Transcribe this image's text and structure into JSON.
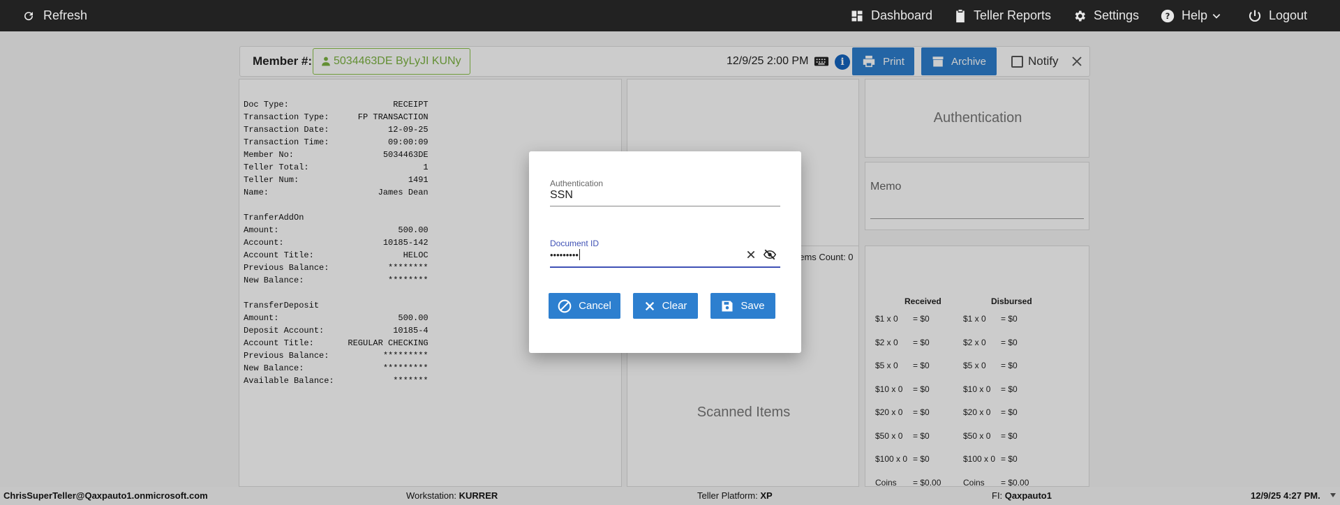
{
  "topbar": {
    "refresh": "Refresh",
    "dashboard": "Dashboard",
    "teller_reports": "Teller Reports",
    "settings": "Settings",
    "help": "Help",
    "logout": "Logout"
  },
  "header": {
    "member_label": "Member #:",
    "member_value": "5034463DE ByLyJI KUNy",
    "datetime": "12/9/25 2:00 PM",
    "print": "Print",
    "archive": "Archive",
    "notify": "Notify"
  },
  "receipt": {
    "rows": [
      {
        "k": "Doc Type:",
        "v": "RECEIPT"
      },
      {
        "k": "Transaction Type:",
        "v": "FP TRANSACTION"
      },
      {
        "k": "Transaction Date:",
        "v": "12-09-25"
      },
      {
        "k": "Transaction Time:",
        "v": "09:00:09"
      },
      {
        "k": "Member No:",
        "v": "5034463DE"
      },
      {
        "k": "Teller Total:",
        "v": "1"
      },
      {
        "k": "Teller Num:",
        "v": "1491"
      },
      {
        "k": "Name:",
        "v": "James Dean"
      },
      {
        "k": "",
        "v": ""
      },
      {
        "k": "TranferAddOn",
        "v": ""
      },
      {
        "k": "Amount:",
        "v": "500.00"
      },
      {
        "k": "Account:",
        "v": "10185-142"
      },
      {
        "k": "Account Title:",
        "v": "HELOC"
      },
      {
        "k": "Previous Balance:",
        "v": "********"
      },
      {
        "k": "New Balance:",
        "v": "********"
      },
      {
        "k": "",
        "v": ""
      },
      {
        "k": "TransferDeposit",
        "v": ""
      },
      {
        "k": "Amount:",
        "v": "500.00"
      },
      {
        "k": "Deposit Account:",
        "v": "10185-4"
      },
      {
        "k": "Account Title:",
        "v": "REGULAR CHECKING"
      },
      {
        "k": "Previous Balance:",
        "v": "*********"
      },
      {
        "k": "New Balance:",
        "v": "*********"
      },
      {
        "k": "Available Balance:",
        "v": "*******"
      }
    ]
  },
  "items_count": "Items Count: 0",
  "scanned_items": "Scanned Items",
  "authentication_card": "Authentication",
  "memo": "Memo",
  "cash": {
    "received": "Received",
    "disbursed": "Disbursed",
    "rows": [
      {
        "d": "$1 x 0",
        "a": "= $0"
      },
      {
        "d": "$2 x 0",
        "a": "= $0"
      },
      {
        "d": "$5 x 0",
        "a": "= $0"
      },
      {
        "d": "$10 x 0",
        "a": "= $0"
      },
      {
        "d": "$20 x 0",
        "a": "= $0"
      },
      {
        "d": "$50 x 0",
        "a": "= $0"
      },
      {
        "d": "$100 x 0",
        "a": "= $0"
      },
      {
        "d": "Coins",
        "a": "= $0.00"
      }
    ]
  },
  "dialog": {
    "auth_label": "Authentication",
    "auth_value": "SSN",
    "doc_label": "Document ID",
    "doc_value": "•••••••••",
    "cancel": "Cancel",
    "clear": "Clear",
    "save": "Save"
  },
  "status": {
    "user": "ChrisSuperTeller@Qaxpauto1.onmicrosoft.com",
    "workstation_label": "Workstation:",
    "workstation": "KURRER",
    "platform_label": "Teller Platform:",
    "platform": "XP",
    "fi_label": "FI:",
    "fi": "Qaxpauto1",
    "time": "12/9/25 4:27 PM."
  }
}
